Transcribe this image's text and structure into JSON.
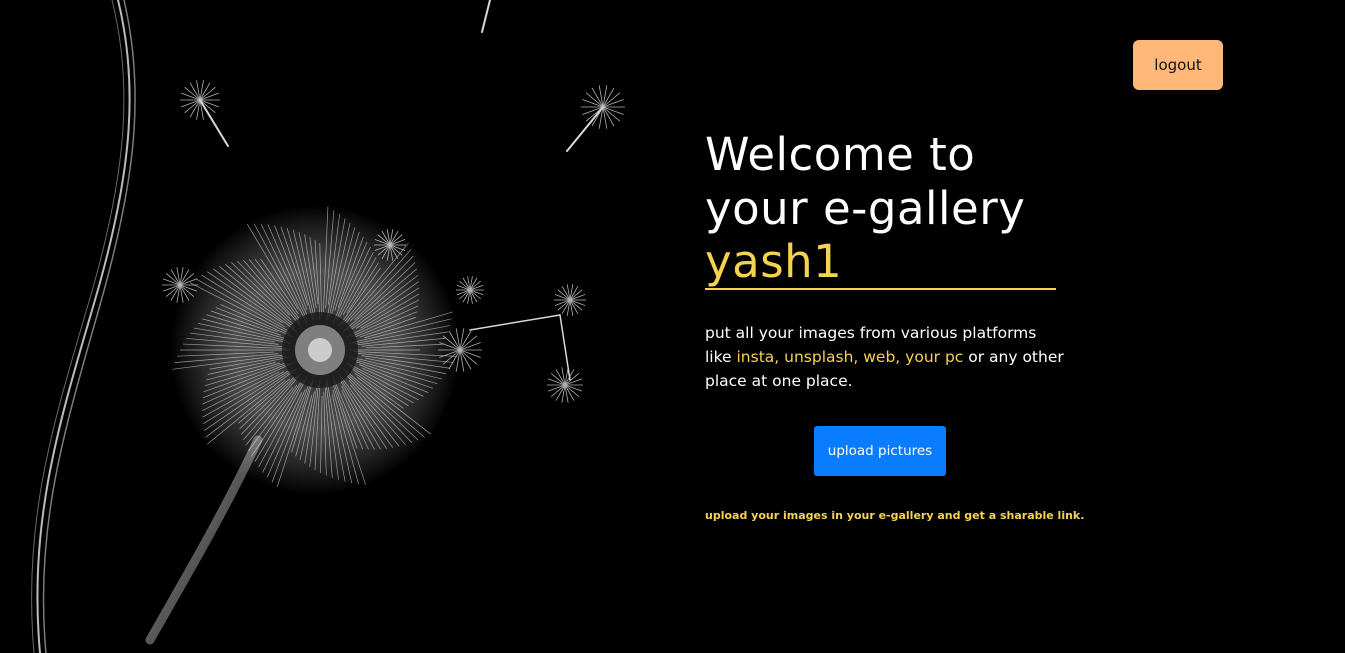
{
  "colors": {
    "background": "#000000",
    "accent_yellow": "#f5d350",
    "logout_bg": "#ffb878",
    "upload_bg": "#0a7cff"
  },
  "header": {
    "logout_label": "logout"
  },
  "hero": {
    "title_line1": "Welcome to",
    "title_line2": "your e-gallery",
    "username": "yash1",
    "description_prefix": "put all your images from various platforms like ",
    "description_highlight": "insta, unsplash, web, your pc",
    "description_suffix": " or any other place at one place.",
    "upload_label": "upload pictures",
    "note": "upload your images in your e-gallery and get a sharable link."
  },
  "background": {
    "illustration": "dandelion-image"
  }
}
